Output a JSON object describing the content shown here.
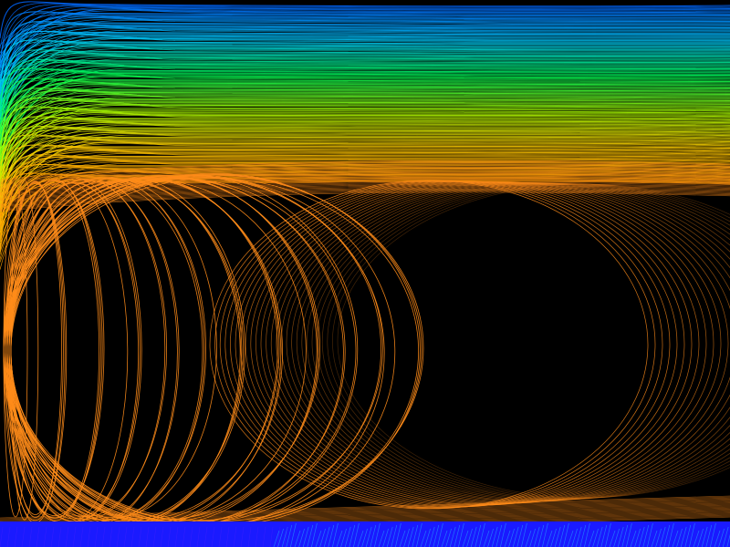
{
  "artwork": {
    "kind": "generative line art",
    "background_color": "#000000",
    "gradient_stops": [
      "#1a1aff",
      "#00e5ff",
      "#00ff44",
      "#ccff00",
      "#ffd000",
      "#ff8c00"
    ],
    "upper_band_colors": [
      "#0066ff",
      "#00ccff",
      "#00ff55",
      "#aaff00",
      "#ffcc00",
      "#ff9900"
    ],
    "ellipse_color": "#ff8c1a",
    "bottom_band_color": "#1a1aff",
    "bottom_band_accent": "#2288ff"
  }
}
